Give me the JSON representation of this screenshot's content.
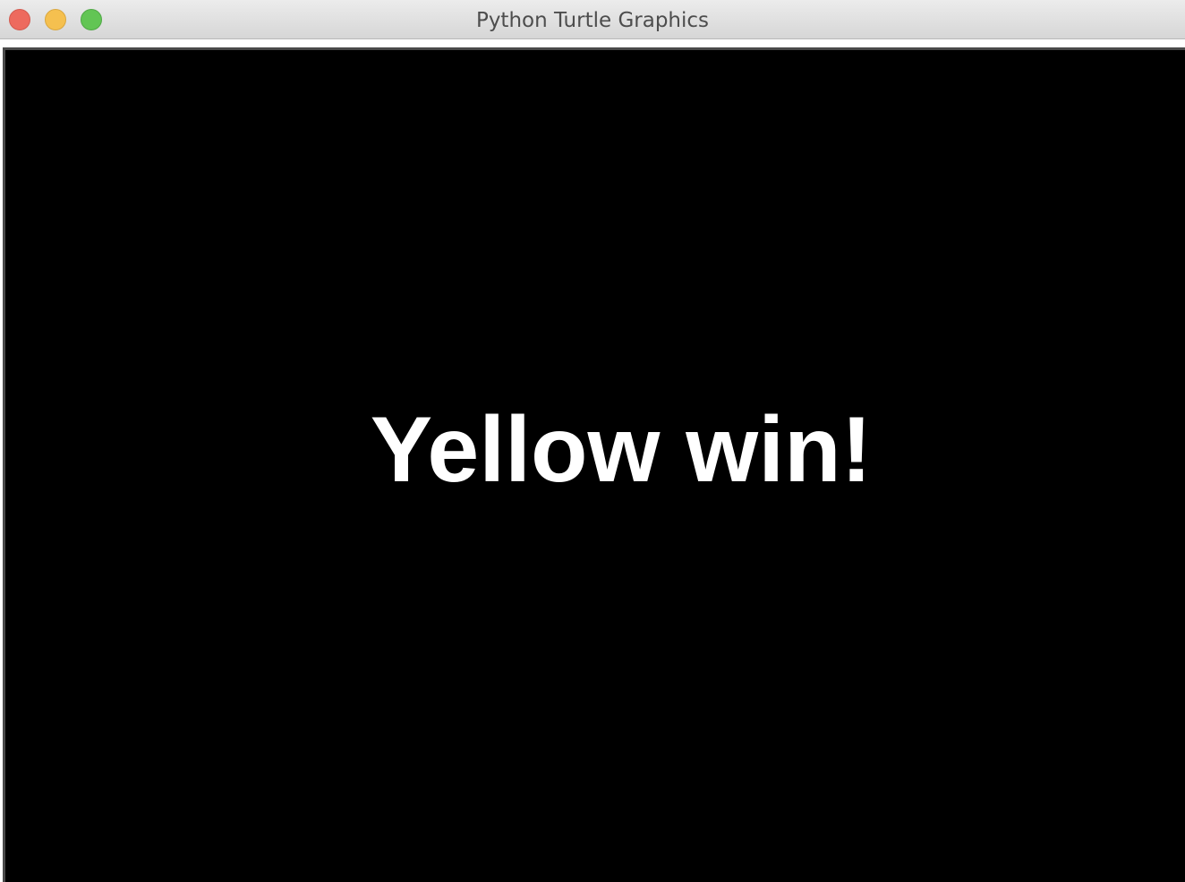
{
  "window": {
    "title": "Python Turtle Graphics",
    "controls": {
      "close_color": "#ed6a5e",
      "minimize_color": "#f5c04f",
      "zoom_color": "#62c554"
    }
  },
  "canvas": {
    "background": "#000000",
    "message": "Yellow win!",
    "message_color": "#ffffff"
  }
}
